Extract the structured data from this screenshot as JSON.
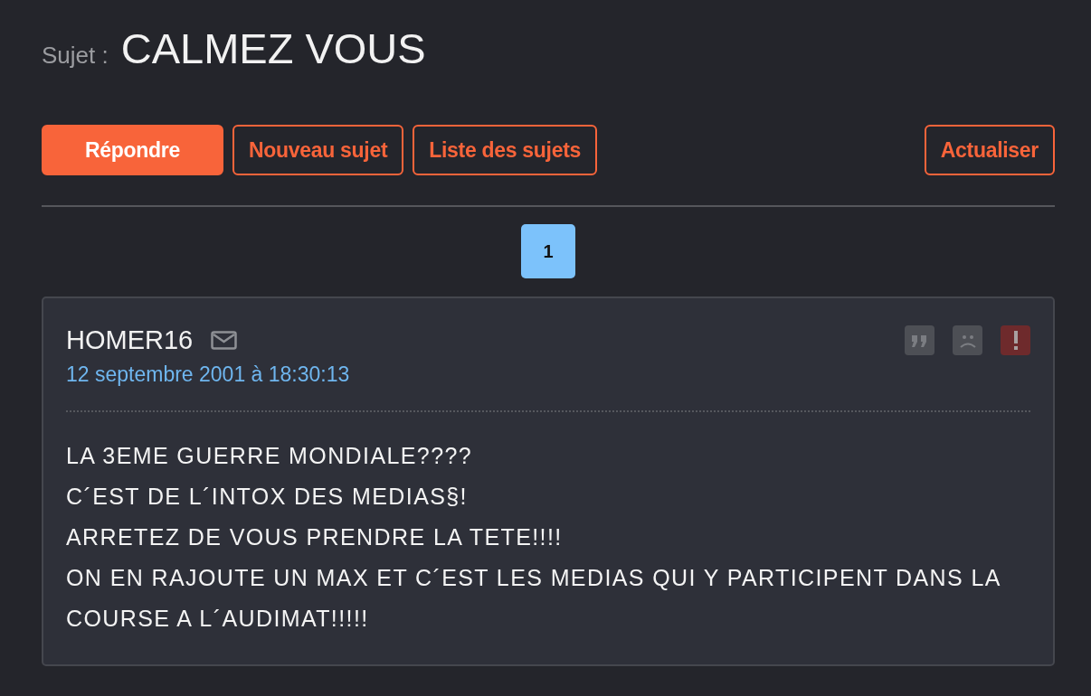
{
  "subject": {
    "label": "Sujet :",
    "title": "CALMEZ VOUS"
  },
  "buttons": [
    {
      "label": "Répondre",
      "kind": "primary"
    },
    {
      "label": "Nouveau sujet",
      "kind": "outline"
    },
    {
      "label": "Liste des sujets",
      "kind": "outline"
    },
    {
      "label": "Actualiser",
      "kind": "outline"
    }
  ],
  "pages": [
    {
      "label": "1",
      "selected": true
    }
  ],
  "post": {
    "author": "HOMER16",
    "date": "12 septembre 2001 à 18:30:13",
    "actions": [
      {
        "kind": "quote"
      },
      {
        "kind": "sad"
      },
      {
        "kind": "alert"
      }
    ],
    "lines": [
      "LA 3EME GUERRE MONDIALE????",
      "C´EST DE L´INTOX DES MEDIAS§!",
      "ARRETEZ DE VOUS PRENDRE LA TETE!!!!",
      "ON EN RAJOUTE UN MAX ET C´EST LES MEDIAS QUI Y PARTICIPENT DANS LA COURSE A L´AUDIMAT!!!!!"
    ]
  }
}
